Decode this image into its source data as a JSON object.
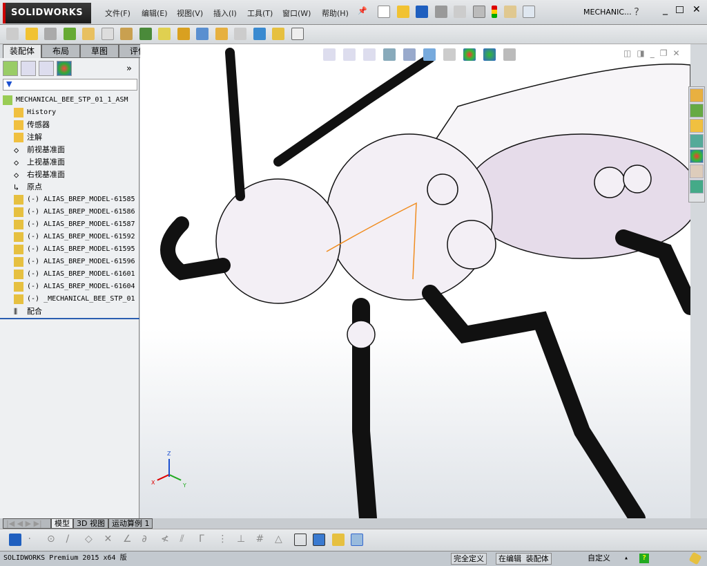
{
  "app": {
    "logo": "SOLIDWORKS",
    "doc_title": "MECHANIC...",
    "help": "?"
  },
  "menu": [
    "文件(F)",
    "编辑(E)",
    "视图(V)",
    "插入(I)",
    "工具(T)",
    "窗口(W)",
    "帮助(H)"
  ],
  "command_tabs": [
    "装配体",
    "布局",
    "草图",
    "评估"
  ],
  "panel": {
    "expand": "»",
    "filter_icon": "filter-icon"
  },
  "tree": {
    "root": "MECHANICAL_BEE_STP_01_1_ASM",
    "items": [
      {
        "label": "History",
        "icon": "history-folder-icon"
      },
      {
        "label": "传感器",
        "icon": "sensor-folder-icon"
      },
      {
        "label": "注解",
        "icon": "annotation-folder-icon",
        "expand": "+"
      },
      {
        "label": "前视基准面",
        "icon": "plane-icon"
      },
      {
        "label": "上视基准面",
        "icon": "plane-icon"
      },
      {
        "label": "右视基准面",
        "icon": "plane-icon"
      },
      {
        "label": "原点",
        "icon": "origin-icon"
      },
      {
        "label": "(-) ALIAS_BREP_MODEL-61585",
        "icon": "part-icon"
      },
      {
        "label": "(-) ALIAS_BREP_MODEL-61586",
        "icon": "part-icon"
      },
      {
        "label": "(-) ALIAS_BREP_MODEL-61587",
        "icon": "part-icon"
      },
      {
        "label": "(-) ALIAS_BREP_MODEL-61592",
        "icon": "part-icon"
      },
      {
        "label": "(-) ALIAS_BREP_MODEL-61595",
        "icon": "part-icon"
      },
      {
        "label": "(-) ALIAS_BREP_MODEL-61596",
        "icon": "part-icon"
      },
      {
        "label": "(-) ALIAS_BREP_MODEL-61601",
        "icon": "part-icon"
      },
      {
        "label": "(-) ALIAS_BREP_MODEL-61604",
        "icon": "part-icon"
      },
      {
        "label": "(-) _MECHANICAL_BEE_STP_01",
        "icon": "part-icon"
      },
      {
        "label": "配合",
        "icon": "mates-icon"
      }
    ]
  },
  "triad": {
    "x": "X",
    "y": "Y",
    "z": "Z"
  },
  "bottom_tabs": [
    "模型",
    "3D 视图",
    "运动算例 1"
  ],
  "status": {
    "product": "SOLIDWORKS Premium 2015 x64 版",
    "defined": "完全定义",
    "editing": "在编辑 装配体",
    "custom": "自定义",
    "help": "?"
  },
  "colors": {
    "accent": "#1a4fd0",
    "logo_bar": "#cc0000",
    "model_fill": "#f3eff5",
    "highlight": "#f08c1e"
  }
}
